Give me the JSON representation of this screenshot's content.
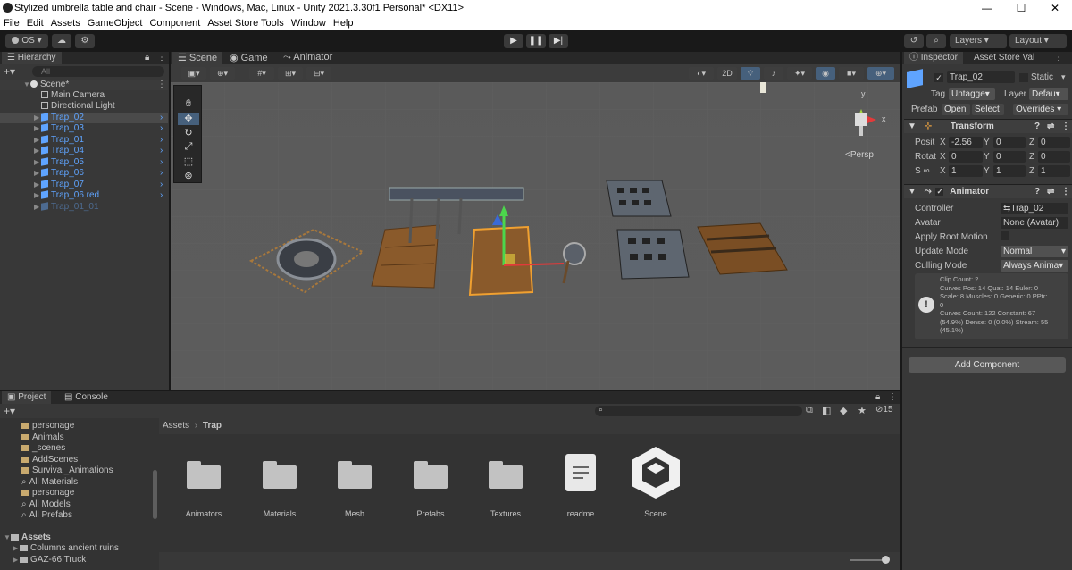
{
  "window": {
    "title": "Stylized umbrella table and chair - Scene - Windows, Mac, Linux - Unity 2021.3.30f1 Personal* <DX11>",
    "minimize": "—",
    "maximize": "☐",
    "close": "✕"
  },
  "menu": [
    "File",
    "Edit",
    "Assets",
    "GameObject",
    "Component",
    "Asset Store Tools",
    "Window",
    "Help"
  ],
  "toolbar": {
    "account": "OS ▾",
    "layers": "Layers",
    "layout": "Layout"
  },
  "hierarchy": {
    "tab": "Hierarchy",
    "search_placeholder": "All",
    "scene": "Scene*",
    "items": [
      {
        "label": "Main Camera",
        "kind": "go"
      },
      {
        "label": "Directional Light",
        "kind": "go"
      },
      {
        "label": "Trap_02",
        "kind": "prefab",
        "selected": true
      },
      {
        "label": "Trap_03",
        "kind": "prefab"
      },
      {
        "label": "Trap_01",
        "kind": "prefab"
      },
      {
        "label": "Trap_04",
        "kind": "prefab"
      },
      {
        "label": "Trap_05",
        "kind": "prefab"
      },
      {
        "label": "Trap_06",
        "kind": "prefab"
      },
      {
        "label": "Trap_07",
        "kind": "prefab"
      },
      {
        "label": "Trap_06 red",
        "kind": "prefab"
      },
      {
        "label": "Trap_01_01",
        "kind": "disabled"
      }
    ]
  },
  "scene_tabs": {
    "scene": "Scene",
    "game": "Game",
    "animator": "Animator"
  },
  "scene_toolbar": {
    "mode2d": "2D"
  },
  "gizmo": {
    "persp": "<Persp",
    "x": "x",
    "y": "y"
  },
  "inspector": {
    "tab": "Inspector",
    "tab2": "Asset Store Val",
    "object_name": "Trap_02",
    "static": "Static",
    "tag_label": "Tag",
    "tag": "Untagge▾",
    "layer_label": "Layer",
    "layer": "Defau▾",
    "prefab_label": "Prefab",
    "open": "Open",
    "select": "Select",
    "overrides": "Overrides ▾",
    "transform": {
      "header": "Transform",
      "pos_label": "Posit",
      "rot_label": "Rotat",
      "scale_label": "S ∞",
      "x": "X",
      "y": "Y",
      "z": "Z",
      "pos": [
        "-2.56",
        "0",
        "0"
      ],
      "rot": [
        "0",
        "0",
        "0"
      ],
      "scale": [
        "1",
        "1",
        "1"
      ]
    },
    "animator": {
      "header": "Animator",
      "controller_label": "Controller",
      "controller": "Trap_02",
      "avatar_label": "Avatar",
      "avatar": "None (Avatar)",
      "root_motion": "Apply Root Motion",
      "update_label": "Update Mode",
      "update": "Normal",
      "culling_label": "Culling Mode",
      "culling": "Always Anima▾",
      "info": [
        "Clip Count: 2",
        "Curves Pos: 14 Quat: 14 Euler: 0",
        "Scale: 8 Muscles: 0 Generic: 0 PPtr:",
        "0",
        "Curves Count: 122 Constant: 67",
        "(54.9%) Dense: 0 (0.0%) Stream: 55",
        "(45.1%)"
      ]
    },
    "add_component": "Add Component"
  },
  "project": {
    "tab": "Project",
    "console": "Console",
    "count": "15",
    "breadcrumb_root": "Assets",
    "breadcrumb_sep": "›",
    "breadcrumb_leaf": "Trap",
    "tree": [
      {
        "label": "personage",
        "kind": "folder"
      },
      {
        "label": "Animals",
        "kind": "folder"
      },
      {
        "label": "_scenes",
        "kind": "folder"
      },
      {
        "label": "AddScenes",
        "kind": "folder"
      },
      {
        "label": "Survival_Animations",
        "kind": "folder"
      },
      {
        "label": "All Materials",
        "kind": "search"
      },
      {
        "label": "personage",
        "kind": "search"
      },
      {
        "label": "All Models",
        "kind": "search"
      },
      {
        "label": "All Prefabs",
        "kind": "search"
      }
    ],
    "assets_header": "Assets",
    "assets_children": [
      {
        "label": "Columns ancient  ruins"
      },
      {
        "label": "GAZ-66 Truck"
      }
    ],
    "grid": [
      {
        "label": "Animators",
        "kind": "folder"
      },
      {
        "label": "Materials",
        "kind": "folder"
      },
      {
        "label": "Mesh",
        "kind": "folder"
      },
      {
        "label": "Prefabs",
        "kind": "folder"
      },
      {
        "label": "Textures",
        "kind": "folder"
      },
      {
        "label": "readme",
        "kind": "doc"
      },
      {
        "label": "Scene",
        "kind": "unity"
      }
    ]
  },
  "colors": {
    "accent": "#5fa4ff",
    "panel": "#383838",
    "bg": "#191919"
  }
}
